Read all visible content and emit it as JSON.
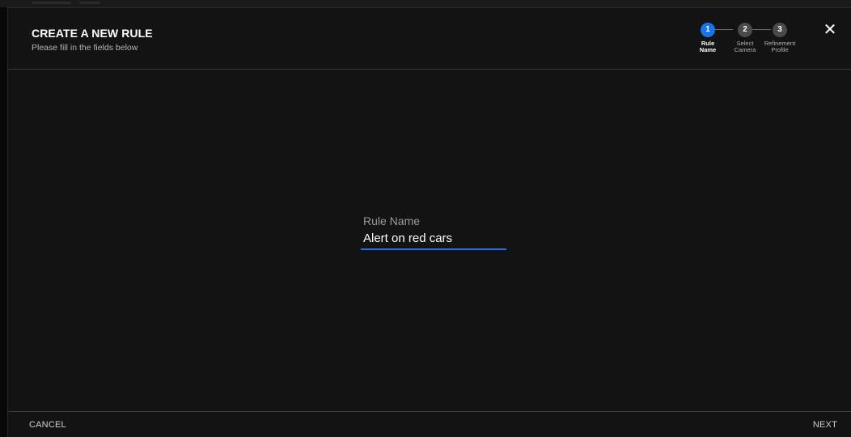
{
  "dialog": {
    "title": "CREATE A NEW RULE",
    "subtitle": "Please fill in the fields below",
    "close_glyph": "✕"
  },
  "stepper": {
    "active_step": 1,
    "steps": [
      {
        "number": "1",
        "label_line1": "Rule",
        "label_line2": "Name"
      },
      {
        "number": "2",
        "label_line1": "Select",
        "label_line2": "Camera"
      },
      {
        "number": "3",
        "label_line1": "Refinement",
        "label_line2": "Profile"
      }
    ]
  },
  "form": {
    "rule_name_label": "Rule Name",
    "rule_name_value": "Alert on red cars"
  },
  "footer": {
    "cancel_label": "CANCEL",
    "next_label": "NEXT"
  },
  "colors": {
    "accent": "#1a73e8",
    "background": "#131313",
    "divider": "#3a3a3a"
  },
  "icons": {
    "close": "close-icon"
  }
}
